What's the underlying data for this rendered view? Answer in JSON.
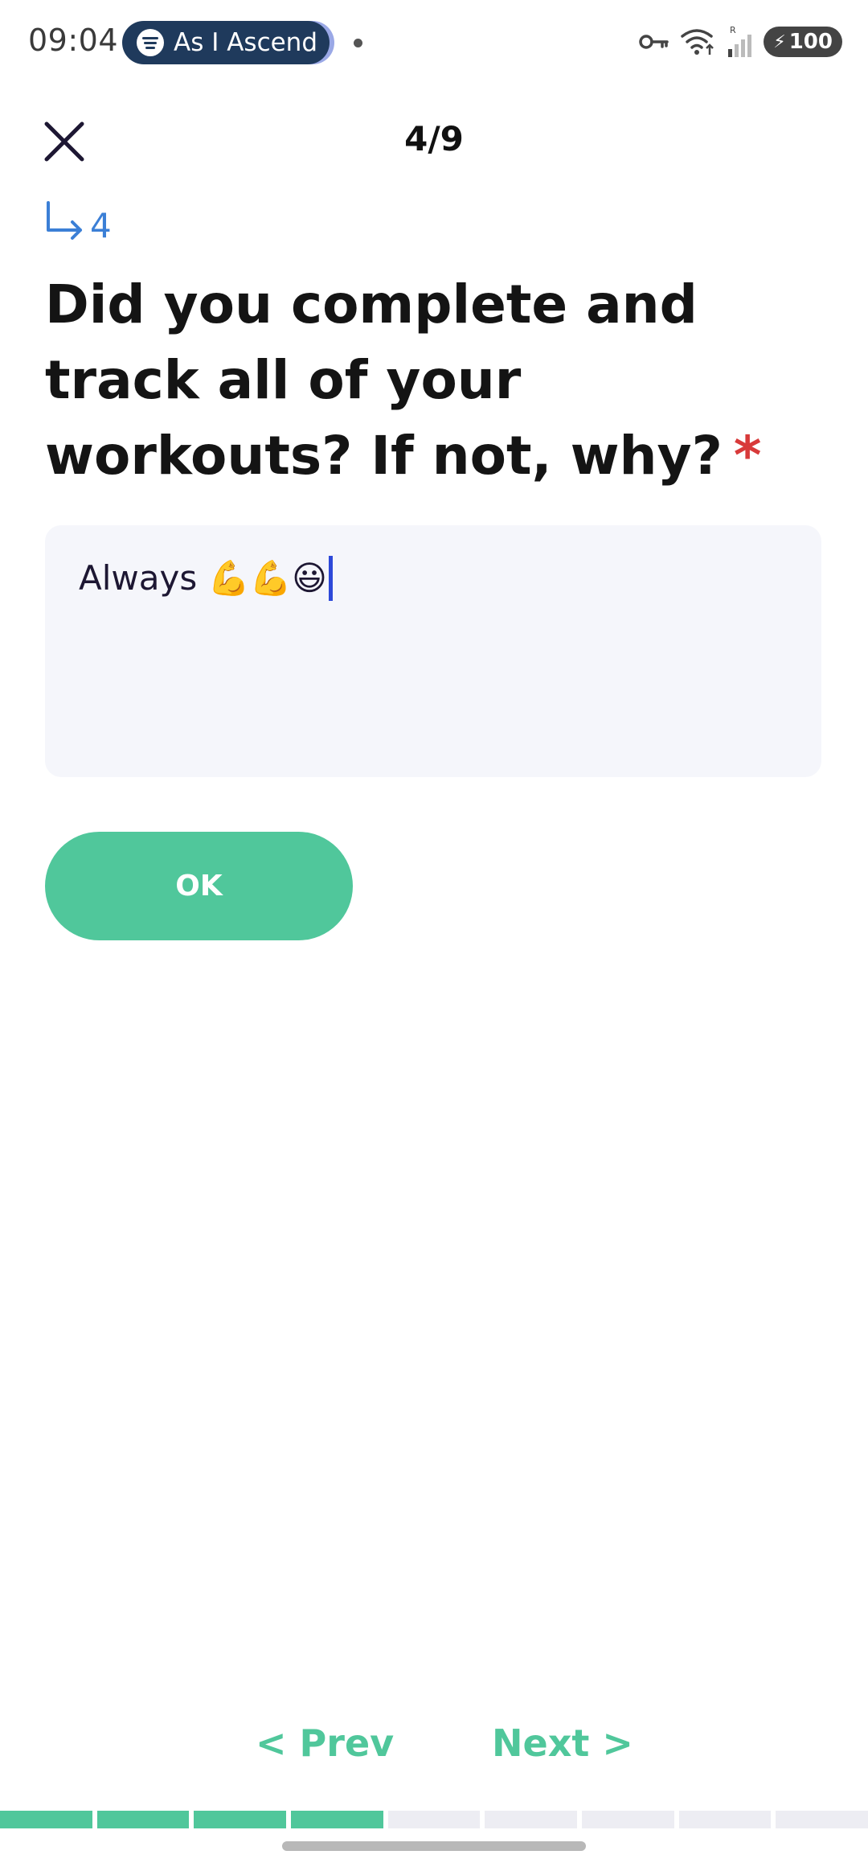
{
  "status_bar": {
    "time": "09:04",
    "media_title": "As I Ascend",
    "battery": "100",
    "icons": [
      "spotify-icon",
      "key-icon",
      "wifi-icon",
      "signal-icon",
      "battery-icon"
    ]
  },
  "header": {
    "close_icon": "close-icon",
    "step_counter": "4/9"
  },
  "question": {
    "number": "4",
    "number_icon": "arrow-turn-down-right-icon",
    "text": "Did you complete and track all of your workouts? If not, why?",
    "required_mark": "*"
  },
  "answer": {
    "value": "Always 💪💪😃"
  },
  "ok_button": {
    "label": "OK"
  },
  "navigation": {
    "prev_label": "< Prev",
    "next_label": "Next >"
  },
  "progress": {
    "total_steps": 9,
    "completed_steps": 4
  },
  "colors": {
    "accent": "#50c79b",
    "link": "#3b7fd6",
    "required": "#d83a3a",
    "input_bg": "#f5f6fb",
    "caret": "#2d49d9"
  }
}
